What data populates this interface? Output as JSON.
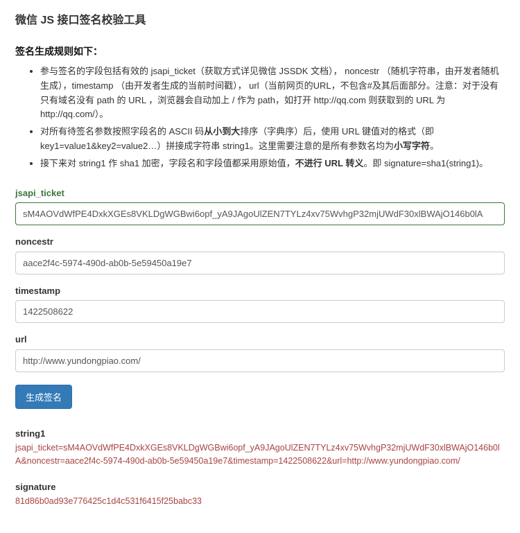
{
  "page_title": "微信 JS 接口签名校验工具",
  "rules_heading": "签名生成规则如下：",
  "rules": [
    {
      "pre": "参与签名的字段包括有效的 jsapi_ticket（获取方式详见微信 JSSDK 文档）， noncestr （随机字符串，由开发者随机生成），timestamp （由开发者生成的当前时间戳）， url（当前网页的URL，不包含#及其后面部分。注意：对于没有只有域名没有 path 的 URL ，浏览器会自动加上 / 作为 path，如打开 http://qq.com 则获取到的 URL 为 http://qq.com/）。"
    },
    {
      "pre": "对所有待签名参数按照字段名的 ASCII 码",
      "b1": "从小到大",
      "mid": "排序（字典序）后，使用 URL 键值对的格式（即key1=value1&key2=value2…）拼接成字符串 string1。这里需要注意的是所有参数名均为",
      "b2": "小写字符",
      "post": "。"
    },
    {
      "pre": "接下来对 string1 作 sha1 加密，字段名和字段值都采用原始值，",
      "b1": "不进行 URL 转义",
      "post": "。即 signature=sha1(string1)。"
    }
  ],
  "form": {
    "jsapi_ticket": {
      "label": "jsapi_ticket",
      "value": "sM4AOVdWfPE4DxkXGEs8VKLDgWGBwi6opf_yA9JAgoUlZEN7TYLz4xv75WvhgP32mjUWdF30xlBWAjO146b0lA"
    },
    "noncestr": {
      "label": "noncestr",
      "value": "aace2f4c-5974-490d-ab0b-5e59450a19e7"
    },
    "timestamp": {
      "label": "timestamp",
      "value": "1422508622"
    },
    "url": {
      "label": "url",
      "value": "http://www.yundongpiao.com/"
    },
    "submit_label": "生成签名"
  },
  "results": {
    "string1": {
      "label": "string1",
      "value": "jsapi_ticket=sM4AOVdWfPE4DxkXGEs8VKLDgWGBwi6opf_yA9JAgoUlZEN7TYLz4xv75WvhgP32mjUWdF30xlBWAjO146b0lA&noncestr=aace2f4c-5974-490d-ab0b-5e59450a19e7&timestamp=1422508622&url=http://www.yundongpiao.com/"
    },
    "signature": {
      "label": "signature",
      "value": "81d86b0ad93e776425c1d4c531f6415f25babc33"
    }
  }
}
